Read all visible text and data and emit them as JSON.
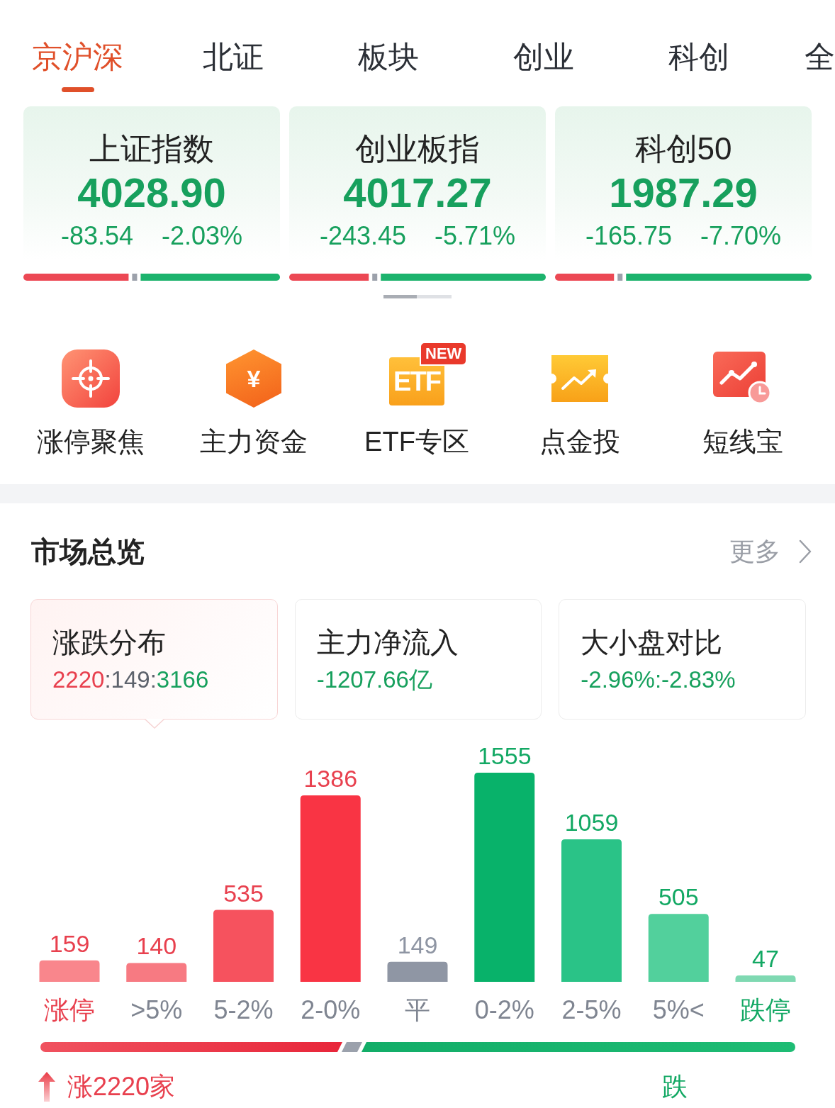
{
  "tabs": [
    {
      "label": "京沪深",
      "selected": true
    },
    {
      "label": "北证",
      "selected": false
    },
    {
      "label": "板块",
      "selected": false
    },
    {
      "label": "创业",
      "selected": false
    },
    {
      "label": "科创",
      "selected": false
    },
    {
      "label": "全",
      "selected": false
    }
  ],
  "index_cards": [
    {
      "name": "上证指数",
      "value": "4028.90",
      "change": "-83.54",
      "change_pct": "-2.03%",
      "color": "#17a05d",
      "level": 0.41
    },
    {
      "name": "创业板指",
      "value": "4017.27",
      "change": "-243.45",
      "change_pct": "-5.71%",
      "color": "#17a05d",
      "level": 0.31
    },
    {
      "name": "科创50",
      "value": "1987.29",
      "change": "-165.75",
      "change_pct": "-7.70%",
      "color": "#17a05d",
      "level": 0.23
    }
  ],
  "shortcuts": [
    {
      "label": "涨停聚焦",
      "kind": "target"
    },
    {
      "label": "主力资金",
      "kind": "yen",
      "icon_text": "¥"
    },
    {
      "label": "ETF专区",
      "kind": "etf",
      "icon_text": "ETF",
      "badge": "NEW"
    },
    {
      "label": "点金投",
      "kind": "ticket"
    },
    {
      "label": "短线宝",
      "kind": "clock-chart"
    }
  ],
  "market_overview": {
    "title": "市场总览",
    "more": "更多",
    "cards": [
      {
        "title": "涨跌分布",
        "selected": true,
        "value_parts": [
          {
            "text": "2220",
            "color": "#e8404e"
          },
          {
            "text": ":149:",
            "color": "#5d626c"
          },
          {
            "text": "3166",
            "color": "#17a05d"
          }
        ]
      },
      {
        "title": "主力净流入",
        "selected": false,
        "value_parts": [
          {
            "text": "-1207.66亿",
            "color": "#17a05d"
          }
        ]
      },
      {
        "title": "大小盘对比",
        "selected": false,
        "value_parts": [
          {
            "text": "-2.96%:-2.83%",
            "color": "#17a05d"
          }
        ]
      }
    ],
    "chart_data": {
      "type": "bar",
      "categories": [
        "涨停",
        ">5%",
        "5-2%",
        "2-0%",
        "平",
        "0-2%",
        "2-5%",
        "5%<",
        "跌停"
      ],
      "values": [
        159,
        140,
        535,
        1386,
        149,
        1555,
        1059,
        505,
        47
      ],
      "data_labels": true,
      "colors": [
        "#f9868c",
        "#f77a82",
        "#f6525e",
        "#f93444",
        "#8f96a4",
        "#08b26a",
        "#2ac387",
        "#52d09c",
        "#7fd9b2"
      ]
    },
    "ratio_bar": {
      "level": 0.4
    },
    "rise_count": "涨2220家",
    "fall_count": "跌"
  }
}
